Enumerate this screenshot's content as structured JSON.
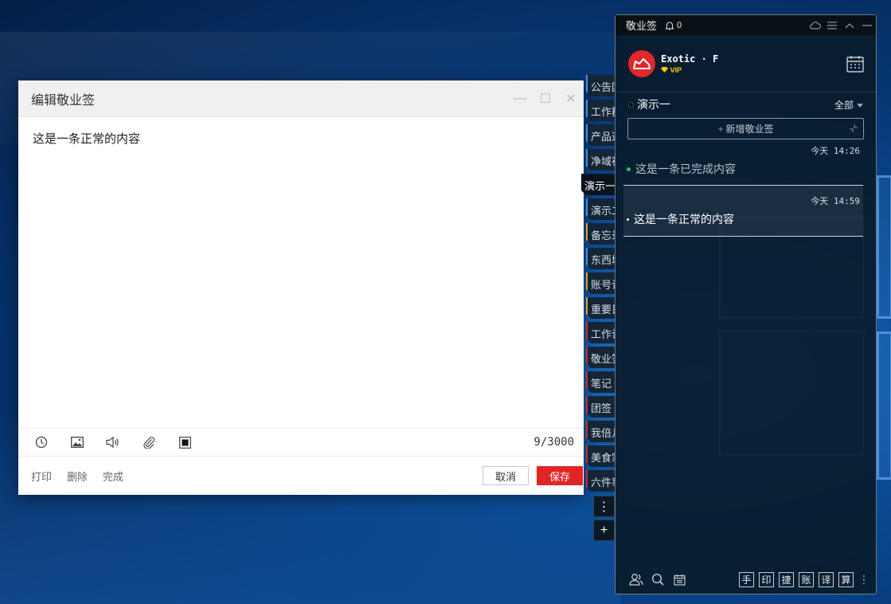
{
  "editor": {
    "title": "编辑敬业签",
    "minimize_glyph": "—",
    "maximize_glyph": "☐",
    "close_glyph": "✕",
    "content": "这是一条正常的内容",
    "char_count": "9/3000",
    "toolbar_icons": [
      "clock-icon",
      "image-icon",
      "speaker-icon",
      "paperclip-icon",
      "stop-icon"
    ],
    "footer": {
      "print": "打印",
      "delete": "删除",
      "complete": "完成",
      "cancel": "取消",
      "save": "保存"
    },
    "save_color": "#e02525"
  },
  "tabs": [
    {
      "label": "公告团",
      "color": "#4a90e2",
      "active": false
    },
    {
      "label": "工作群",
      "color": "#4a90e2",
      "active": false
    },
    {
      "label": "产品通",
      "color": "#4a90e2",
      "active": false
    },
    {
      "label": "净域社",
      "color": "#4a90e2",
      "active": false
    },
    {
      "label": "演示一",
      "color": "#4a90e2",
      "active": true
    },
    {
      "label": "演示二",
      "color": "#4a90e2",
      "active": false
    },
    {
      "label": "备忘录",
      "color": "#e0a030",
      "active": false
    },
    {
      "label": "东西城",
      "color": "#4a90e2",
      "active": false
    },
    {
      "label": "账号记",
      "color": "#e0a030",
      "active": false
    },
    {
      "label": "重要日",
      "color": "#e0a030",
      "active": false
    },
    {
      "label": "工作记",
      "color": "#c03030",
      "active": false
    },
    {
      "label": "敬业签",
      "color": "#c03030",
      "active": false
    },
    {
      "label": "笔记",
      "color": "#c03030",
      "active": false
    },
    {
      "label": "团签",
      "color": "#c03030",
      "active": false
    },
    {
      "label": "我倍儿",
      "color": "#c03030",
      "active": false
    },
    {
      "label": "美食家",
      "color": "#c03030",
      "active": false
    },
    {
      "label": "六件事",
      "color": "#c03030",
      "active": false
    }
  ],
  "side_buttons": {
    "more": "⋮",
    "add": "+"
  },
  "panel": {
    "app_name": "敬业签",
    "notification_count": "0",
    "user": {
      "name": "Exotic · F",
      "badge": "VIP"
    },
    "group": {
      "name": "演示一",
      "filter": "全部"
    },
    "add_note_label": "新增敬业签",
    "notes": [
      {
        "time": "今天 14:26",
        "text": "这是一条已完成内容",
        "bullet_color": "#29c06a",
        "text_color": "#b9c1c8",
        "done": true
      },
      {
        "time": "今天 14:59",
        "text": "这是一条正常的内容",
        "bullet_color": "#ffffff",
        "text_color": "#ffffff",
        "done": false
      }
    ],
    "quick_buttons": [
      "手",
      "印",
      "捷",
      "账",
      "译",
      "算"
    ],
    "more": "⋮"
  }
}
